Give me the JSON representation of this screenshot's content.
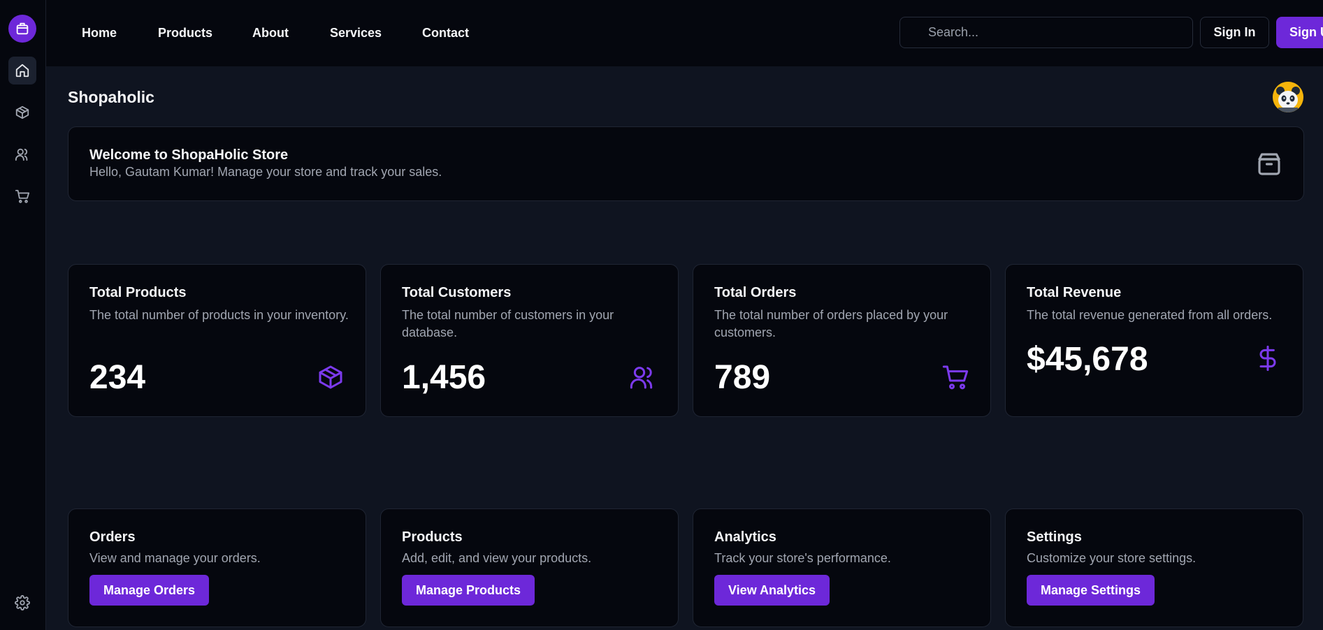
{
  "nav": {
    "links": [
      "Home",
      "Products",
      "About",
      "Services",
      "Contact"
    ],
    "search_placeholder": "Search...",
    "sign_in": "Sign In",
    "sign_up": "Sign Up"
  },
  "sidebar": {
    "items": [
      "home-icon",
      "package-icon",
      "users-icon",
      "cart-icon"
    ],
    "bottom": "settings-icon"
  },
  "page": {
    "title": "Shopaholic"
  },
  "welcome": {
    "title": "Welcome to ShopaHolic Store",
    "subtitle": "Hello, Gautam Kumar! Manage your store and track your sales."
  },
  "stats": [
    {
      "title": "Total Products",
      "desc": "The total number of products in your inventory.",
      "value": "234",
      "icon": "package-icon"
    },
    {
      "title": "Total Customers",
      "desc": "The total number of customers in your database.",
      "value": "1,456",
      "icon": "users-icon"
    },
    {
      "title": "Total Orders",
      "desc": "The total number of orders placed by your customers.",
      "value": "789",
      "icon": "cart-icon"
    },
    {
      "title": "Total Revenue",
      "desc": "The total revenue generated from all orders.",
      "value": "$45,678",
      "icon": "dollar-icon"
    }
  ],
  "actions": [
    {
      "title": "Orders",
      "desc": "View and manage your orders.",
      "button": "Manage Orders"
    },
    {
      "title": "Products",
      "desc": "Add, edit, and view your products.",
      "button": "Manage Products"
    },
    {
      "title": "Analytics",
      "desc": "Track your store's performance.",
      "button": "View Analytics"
    },
    {
      "title": "Settings",
      "desc": "Customize your store settings.",
      "button": "Manage Settings"
    }
  ],
  "colors": {
    "accent": "#6d28d9",
    "background": "#0f1420",
    "surface": "#05070e",
    "muted_text": "#a1a6b1"
  }
}
